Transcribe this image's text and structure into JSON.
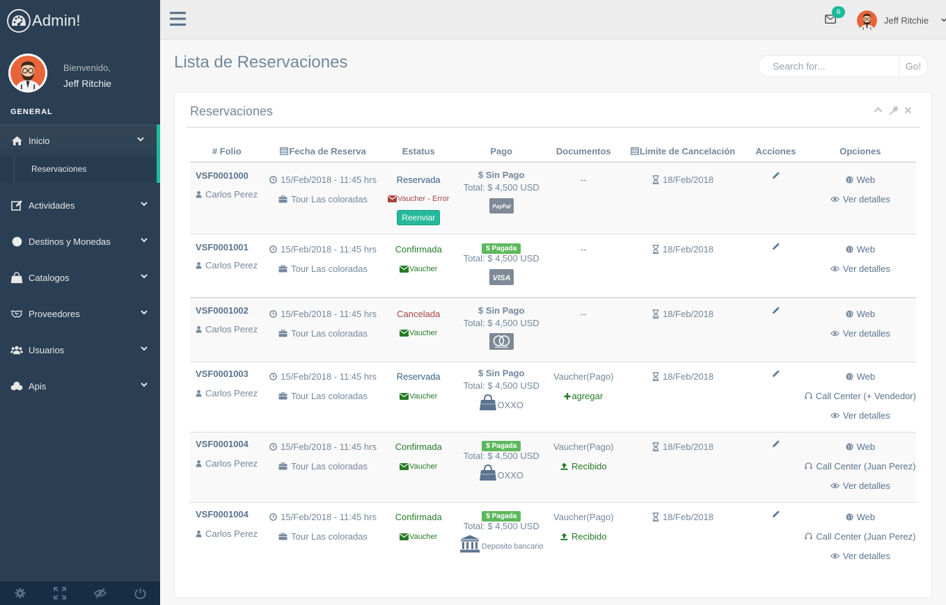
{
  "brand": {
    "name": "Admin!",
    "icon": "dashboard-icon"
  },
  "profile": {
    "welcome": "Bienvenido,",
    "name": "Jeff Ritchie"
  },
  "sidebar": {
    "section": "GENERAL",
    "items": [
      {
        "label": "Inicio",
        "icon": "home-icon"
      },
      {
        "label": "Actividades",
        "icon": "edit-icon"
      },
      {
        "label": "Destinos y Monedas",
        "icon": "globe-icon"
      },
      {
        "label": "Catalogos",
        "icon": "shopping-bag-icon"
      },
      {
        "label": "Proveedores",
        "icon": "handshake-icon"
      },
      {
        "label": "Usuarios",
        "icon": "users-icon"
      },
      {
        "label": "Apis",
        "icon": "cubes-icon"
      }
    ],
    "submenu": [
      {
        "label": "Reservaciones"
      }
    ],
    "footer": [
      "settings-icon",
      "fullscreen-icon",
      "lock-icon",
      "logout-icon"
    ]
  },
  "topnav": {
    "mail_count": "6",
    "user": "Jeff Ritchie"
  },
  "page": {
    "title": "Lista de Reservaciones"
  },
  "search": {
    "placeholder": "Search for...",
    "button": "Go!"
  },
  "panel": {
    "title": "Reservaciones"
  },
  "table": {
    "headers": {
      "folio": "# Folio",
      "fecha": "Fecha de Reserva",
      "estatus": "Estatus",
      "pago": "Pago",
      "documentos": "Documentos",
      "limite": "Limite de Cancelación",
      "acciones": "Acciones",
      "opciones": "Opciones"
    },
    "rows": [
      {
        "folio": "VSF0001000",
        "cliente": "Carlos Perez",
        "fecha": "15/Feb/2018 - 11:45 hrs",
        "tour": "Tour Las coloradas",
        "estatus": "Reservada",
        "vaucher": "Vaucher - Error",
        "button": "Reenviar",
        "pago": "$ Sin Pago",
        "total": "Total: $ 4,500 USD",
        "method": "PayPal",
        "doc": "--",
        "limite": "18/Feb/2018",
        "opt_web": "Web",
        "opt_det": "Ver detalles"
      },
      {
        "folio": "VSF0001001",
        "cliente": "Carlos Perez",
        "fecha": "15/Feb/2018 - 11:45 hrs",
        "tour": "Tour Las coloradas",
        "estatus": "Confirmada",
        "vaucher": "Vaucher",
        "pago": "$ Pagada",
        "total": "Total: $ 4,500 USD",
        "method": "VISA",
        "doc": "--",
        "limite": "18/Feb/2018",
        "opt_web": "Web",
        "opt_det": "Ver detalles"
      },
      {
        "folio": "VSF0001002",
        "cliente": "Carlos Perez",
        "fecha": "15/Feb/2018 - 11:45 hrs",
        "tour": "Tour Las coloradas",
        "estatus": "Cancelada",
        "vaucher": "Vaucher",
        "pago": "$ Sin Pago",
        "total": "Total: $ 4,500 USD",
        "method": "mastercard",
        "doc": "--",
        "limite": "18/Feb/2018",
        "opt_web": "Web",
        "opt_det": "Ver detalles"
      },
      {
        "folio": "VSF0001003",
        "cliente": "Carlos Perez",
        "fecha": "15/Feb/2018 - 11:45 hrs",
        "tour": "Tour Las coloradas",
        "estatus": "Reservada",
        "vaucher": "Vaucher",
        "pago": "$ Sin Pago",
        "total": "Total: $ 4,500 USD",
        "method": "OXXO",
        "doc": "Vaucher(Pago)",
        "doc_action": "agregar",
        "limite": "18/Feb/2018",
        "opt_web": "Web",
        "opt_cc": "Call Center (+ Vendedor)",
        "opt_det": "Ver detalles"
      },
      {
        "folio": "VSF0001004",
        "cliente": "Carlos Perez",
        "fecha": "15/Feb/2018 - 11:45 hrs",
        "tour": "Tour Las coloradas",
        "estatus": "Confirmada",
        "vaucher": "Vaucher",
        "pago": "$ Pagada",
        "total": "Total: $ 4,500 USD",
        "method": "OXXO",
        "doc": "Vaucher(Pago)",
        "doc_action": "Recibido",
        "limite": "18/Feb/2018",
        "opt_web": "Web",
        "opt_cc": "Call Center (Juan Perez)",
        "opt_det": "Ver detalles"
      },
      {
        "folio": "VSF0001004",
        "cliente": "Carlos Perez",
        "fecha": "15/Feb/2018 - 11:45 hrs",
        "tour": "Tour Las coloradas",
        "estatus": "Confirmada",
        "vaucher": "Vaucher",
        "pago": "$ Pagada",
        "total": "Total: $ 4,500 USD",
        "method": "Deposito bancario",
        "doc": "Vaucher(Pago)",
        "doc_action": "Recibido",
        "limite": "18/Feb/2018",
        "opt_web": "Web",
        "opt_cc": "Call Center (Juan Perez)",
        "opt_det": "Ver detalles"
      }
    ]
  },
  "colors": {
    "sidebar": "#2a3f54",
    "accent": "#1abb9c",
    "success": "#5cb85c",
    "danger": "#a94442"
  }
}
